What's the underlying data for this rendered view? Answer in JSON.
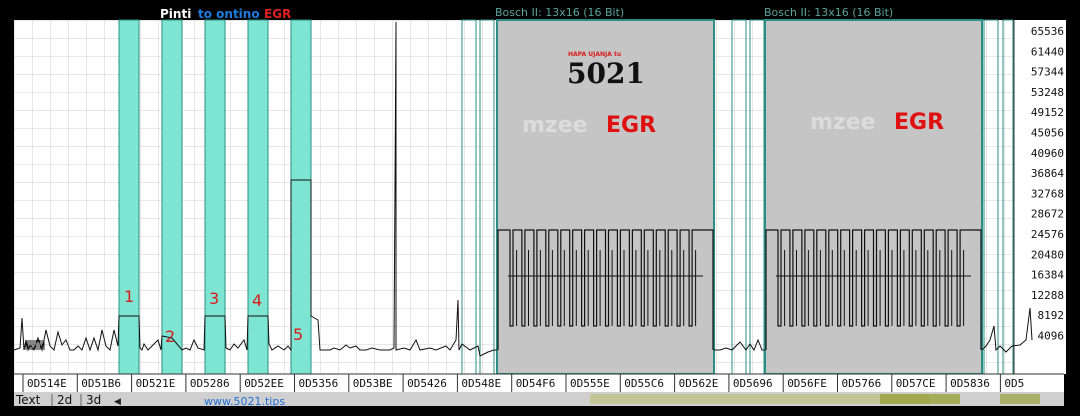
{
  "header": {
    "prefix": "Pinti",
    "middle": "to ontino",
    "suffix": "EGR",
    "map_title_1": "Bosch II: 13x16 (16 Bit)",
    "map_title_2": "Bosch II: 13x16 (16 Bit)"
  },
  "logo": {
    "small_text": "HAPA UJANJA tu",
    "big_text": "5021"
  },
  "watermarks": [
    {
      "gray": "mzee",
      "red": "EGR"
    },
    {
      "gray": "mzee",
      "red": "EGR"
    }
  ],
  "markers": [
    "1",
    "2",
    "3",
    "4",
    "5"
  ],
  "x_axis_labels": [
    "0D514E",
    "0D51B6",
    "0D521E",
    "0D5286",
    "0D52EE",
    "0D5356",
    "0D53BE",
    "0D5426",
    "0D548E",
    "0D54F6",
    "0D555E",
    "0D55C6",
    "0D562E",
    "0D5696",
    "0D56FE",
    "0D5766",
    "0D57CE",
    "0D5836",
    "0D5"
  ],
  "y_axis_labels": [
    "65536",
    "61440",
    "57344",
    "53248",
    "49152",
    "45056",
    "40960",
    "36864",
    "32768",
    "28672",
    "24576",
    "20480",
    "16384",
    "12288",
    "8192",
    "4096"
  ],
  "bottom": {
    "tabs": [
      "Text",
      "2d",
      "3d"
    ],
    "url": "www.5021.tips"
  },
  "colors": {
    "highlight": "#7fe5d3",
    "map_fill": "#c5c5c5",
    "marker": "#d81b1b",
    "grid": "#cfcfcf"
  }
}
